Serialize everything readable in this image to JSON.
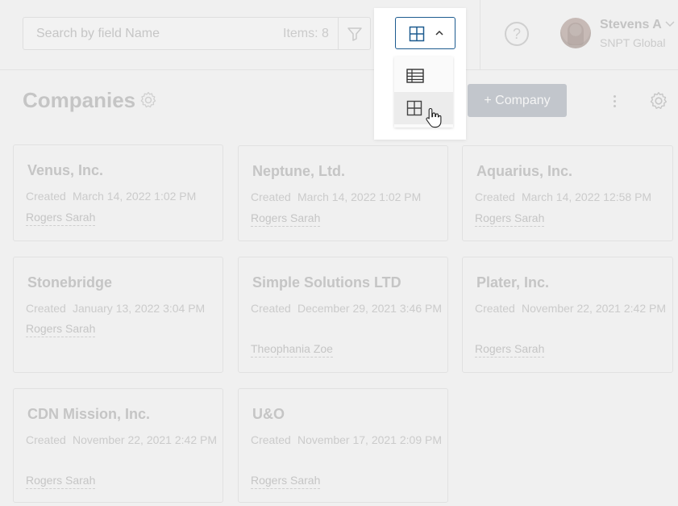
{
  "search": {
    "placeholder": "Search by field Name",
    "value": "",
    "count_label": "Items: 8"
  },
  "user": {
    "name": "Stevens A",
    "org": "SNPT Global"
  },
  "page": {
    "title": "Companies",
    "add_button": "+ Company"
  },
  "view_switcher": {
    "selected": "grid",
    "options": [
      "table",
      "grid"
    ]
  },
  "cards": [
    {
      "name": "Venus, Inc.",
      "created_label": "Created",
      "created": "March 14, 2022 1:02 PM",
      "owner": "Rogers Sarah"
    },
    {
      "name": "Neptune, Ltd.",
      "created_label": "Created",
      "created": "March 14, 2022 1:02 PM",
      "owner": "Rogers Sarah"
    },
    {
      "name": "Aquarius, Inc.",
      "created_label": "Created",
      "created": "March 14, 2022 12:58 PM",
      "owner": "Rogers Sarah"
    },
    {
      "name": "Stonebridge",
      "created_label": "Created",
      "created": "January 13, 2022 3:04 PM",
      "owner": "Rogers Sarah"
    },
    {
      "name": "Simple Solutions LTD",
      "created_label": "Created",
      "created": "December 29, 2021 3:46 PM",
      "owner": "Theophania Zoe"
    },
    {
      "name": "Plater, Inc.",
      "created_label": "Created",
      "created": "November 22, 2021 2:42 PM",
      "owner": "Rogers Sarah"
    },
    {
      "name": "CDN Mission, Inc.",
      "created_label": "Created",
      "created": "November 22, 2021 2:42 PM",
      "owner": "Rogers Sarah"
    },
    {
      "name": "U&O",
      "created_label": "Created",
      "created": "November 17, 2021 2:09 PM",
      "owner": "Rogers Sarah"
    }
  ],
  "colors": {
    "accent": "#1d5b8f",
    "add_button_bg": "#c2c6cc",
    "dim_text": "#c5c5c5"
  }
}
